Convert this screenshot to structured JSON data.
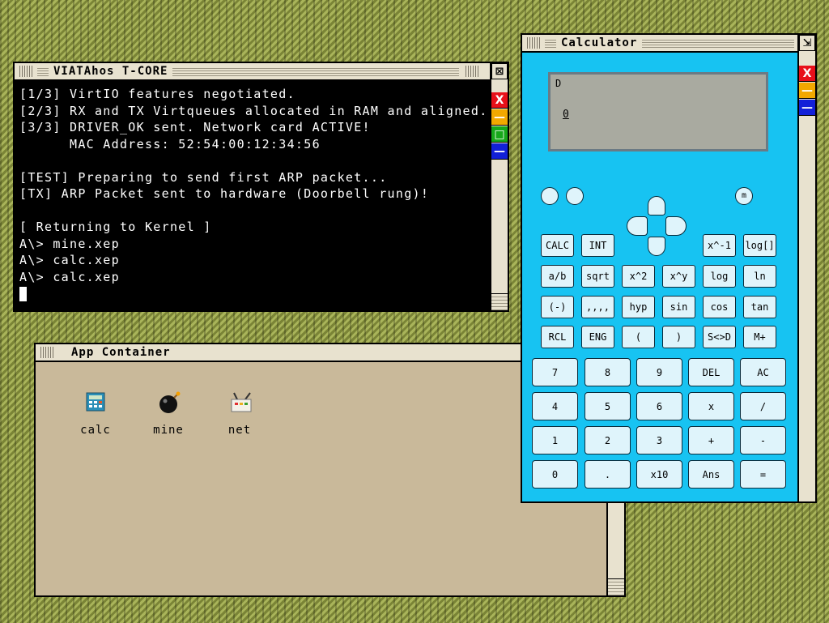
{
  "terminal": {
    "title": "VIATAhos T-CORE",
    "lines": [
      "[1/3] VirtIO features negotiated.",
      "[2/3] RX and TX Virtqueues allocated in RAM and aligned.",
      "[3/3] DRIVER_OK sent. Network card ACTIVE!",
      "      MAC Address: 52:54:00:12:34:56",
      "",
      "[TEST] Preparing to send first ARP packet...",
      "[TX] ARP Packet sent to hardware (Doorbell rung)!",
      "",
      "[ Returning to Kernel ]",
      "A\\> mine.xep",
      "A\\> calc.xep",
      "A\\> calc.xep"
    ]
  },
  "app_container": {
    "title": "App Container",
    "apps": [
      {
        "label": "calc",
        "icon": "calculator-icon"
      },
      {
        "label": "mine",
        "icon": "bomb-icon"
      },
      {
        "label": "net",
        "icon": "network-icon"
      }
    ]
  },
  "calculator": {
    "title": "Calculator",
    "display": {
      "mode": "D",
      "value": "0"
    },
    "round_button_m": "m",
    "row1": [
      "CALC",
      "INT",
      "x^-1",
      "log[]"
    ],
    "row2": [
      "a/b",
      "sqrt",
      "x^2",
      "x^y",
      "log",
      "ln"
    ],
    "row3": [
      "(-)",
      ",,,,",
      "hyp",
      "sin",
      "cos",
      "tan"
    ],
    "row4": [
      "RCL",
      "ENG",
      "(",
      ")",
      "S<>D",
      "M+"
    ],
    "keypad": [
      [
        "7",
        "8",
        "9",
        "DEL",
        "AC"
      ],
      [
        "4",
        "5",
        "6",
        "x",
        "/"
      ],
      [
        "1",
        "2",
        "3",
        "+",
        "-"
      ],
      [
        "0",
        ".",
        "x10",
        "Ans",
        "="
      ]
    ]
  },
  "window_controls": {
    "close": "X",
    "min": "—",
    "max": "□",
    "shade": "—"
  }
}
